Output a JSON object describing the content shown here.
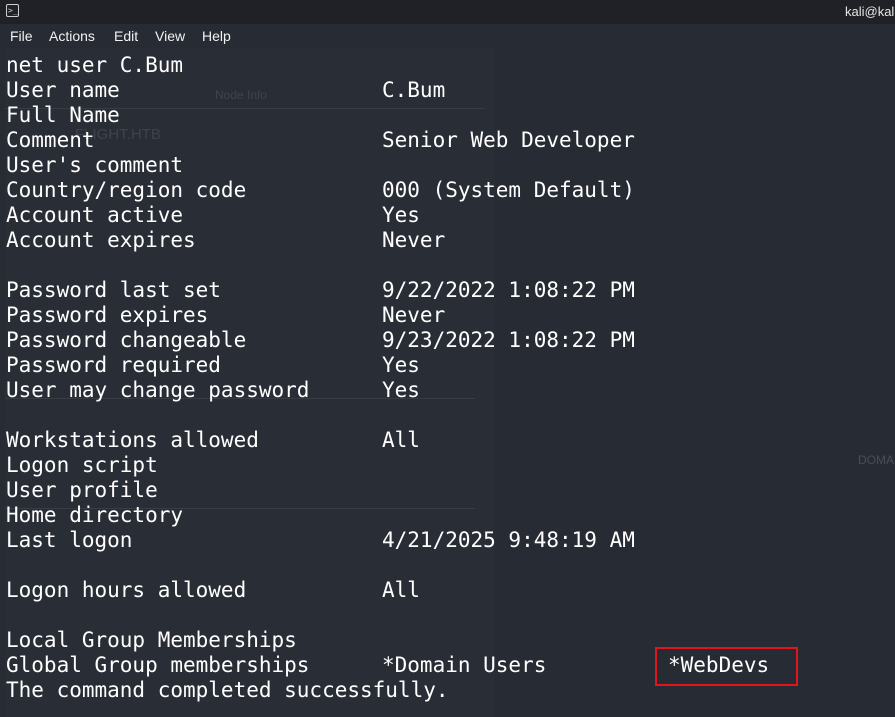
{
  "window": {
    "title": "kali@kali"
  },
  "menu": {
    "items": [
      "File",
      "Actions",
      "Edit",
      "View",
      "Help"
    ]
  },
  "terminal": {
    "command": "net user C.Bum",
    "lines": [
      {
        "label": "User name",
        "value": "C.Bum"
      },
      {
        "label": "Full Name",
        "value": ""
      },
      {
        "label": "Comment",
        "value": "Senior Web Developer"
      },
      {
        "label": "User's comment",
        "value": ""
      },
      {
        "label": "Country/region code",
        "value": "000 (System Default)"
      },
      {
        "label": "Account active",
        "value": "Yes"
      },
      {
        "label": "Account expires",
        "value": "Never"
      },
      {
        "label": "",
        "value": ""
      },
      {
        "label": "Password last set",
        "value": "9/22/2022 1:08:22 PM"
      },
      {
        "label": "Password expires",
        "value": "Never"
      },
      {
        "label": "Password changeable",
        "value": "9/23/2022 1:08:22 PM"
      },
      {
        "label": "Password required",
        "value": "Yes"
      },
      {
        "label": "User may change password",
        "value": "Yes"
      },
      {
        "label": "",
        "value": ""
      },
      {
        "label": "Workstations allowed",
        "value": "All"
      },
      {
        "label": "Logon script",
        "value": ""
      },
      {
        "label": "User profile",
        "value": ""
      },
      {
        "label": "Home directory",
        "value": ""
      },
      {
        "label": "Last logon",
        "value": "4/21/2025 9:48:19 AM"
      },
      {
        "label": "",
        "value": ""
      },
      {
        "label": "Logon hours allowed",
        "value": "All"
      },
      {
        "label": "",
        "value": ""
      },
      {
        "label": "Local Group Memberships",
        "value": ""
      },
      {
        "label": "Global Group memberships",
        "value": "*Domain Users",
        "value2": "*WebDevs"
      }
    ],
    "completion": "The command completed successfully."
  },
  "background_ghost": {
    "texts": [
      "Node Info",
      "FLIGHT.HTB",
      "DOMA"
    ]
  },
  "colors": {
    "terminal_bg": "#272b33",
    "text": "#ffffff",
    "highlight": "#e3141c"
  }
}
